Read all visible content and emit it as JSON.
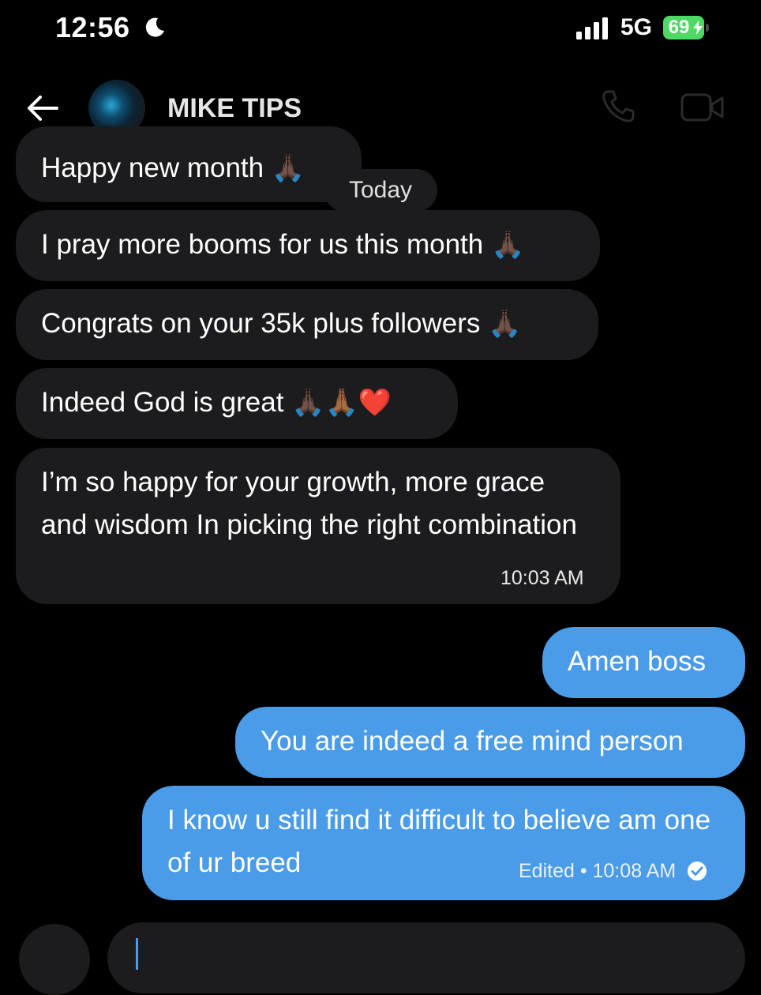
{
  "status_bar": {
    "time": "12:56",
    "network": "5G",
    "battery": "69",
    "battery_color": "#4cd964"
  },
  "header": {
    "contact_name": "MIKE TIPS",
    "icons": [
      "back-arrow-icon",
      "avatar",
      "phone-icon",
      "video-call-icon"
    ]
  },
  "date_separator": "Today",
  "messages": {
    "incoming": [
      {
        "text": "Happy new month",
        "emoji": "🙏🏿"
      },
      {
        "text": "I pray more booms for us this month",
        "emoji": "🙏🏿"
      },
      {
        "text": "Congrats on your 35k plus followers",
        "emoji": "🙏🏿"
      },
      {
        "text": "Indeed God is great",
        "emoji": "🙏🏿🙏🏾❤️"
      },
      {
        "text": "I’m so happy for your growth, more grace and wisdom In picking the right combination",
        "time": "10:03 AM"
      }
    ],
    "outgoing": [
      {
        "text": "Amen boss"
      },
      {
        "text": "You are indeed a free mind person"
      },
      {
        "text": "I know u still find it difficult to believe am one of ur breed",
        "meta": "Edited • 10:08 AM"
      }
    ]
  },
  "colors": {
    "background": "#000000",
    "incoming_bubble": "#1c1c1e",
    "outgoing_bubble": "#4a9be8"
  }
}
